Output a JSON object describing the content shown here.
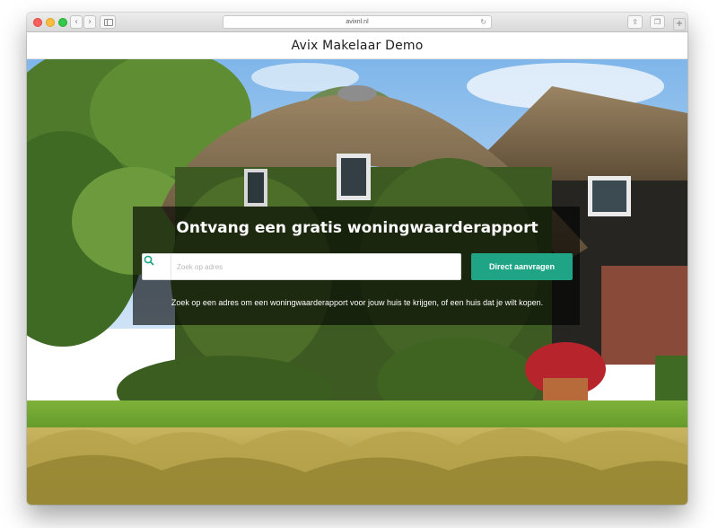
{
  "browser": {
    "url": "avixnl.nl",
    "icons": {
      "back": "chevron-left-icon",
      "forward": "chevron-right-icon",
      "sidebar": "sidebar-icon",
      "reload": "reload-icon",
      "share": "share-icon",
      "tabs": "tabs-icon",
      "new_tab": "plus-icon"
    }
  },
  "site": {
    "title": "Avix Makelaar Demo"
  },
  "hero": {
    "heading": "Ontvang een gratis woningwaarderapport",
    "search_placeholder": "Zoek op adres",
    "cta_label": "Direct aanvragen",
    "helper_text": "Zoek op een adres om een woningwaarderapport voor jouw huis te krijgen, of een huis dat je wilt kopen."
  },
  "colors": {
    "accent": "#1fa486",
    "overlay": "rgba(0,0,0,0.62)"
  }
}
